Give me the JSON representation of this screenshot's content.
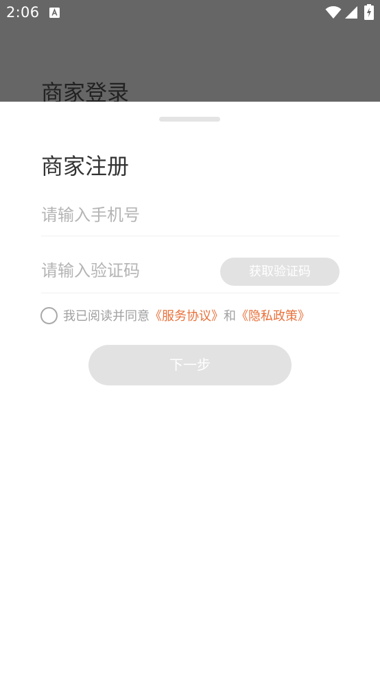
{
  "status_bar": {
    "time": "2:06",
    "icons": [
      "app-notification-icon",
      "wifi-icon",
      "signal-icon",
      "battery-charging-icon"
    ]
  },
  "background_page": {
    "title": "商家登录"
  },
  "sheet": {
    "title": "商家注册",
    "phone_input": {
      "placeholder": "请输入手机号",
      "value": ""
    },
    "code_input": {
      "placeholder": "请输入验证码",
      "value": ""
    },
    "get_code_label": "获取验证码",
    "agreement": {
      "checked": false,
      "prefix": "我已阅读并同意",
      "service_link": "《服务协议》",
      "conjunction": "和",
      "privacy_link": "《隐私政策》"
    },
    "next_label": "下一步"
  },
  "colors": {
    "link": "#e8703a",
    "disabled_button": "#e2e2e2",
    "placeholder": "#b4b4b4",
    "backdrop": "#666666"
  }
}
